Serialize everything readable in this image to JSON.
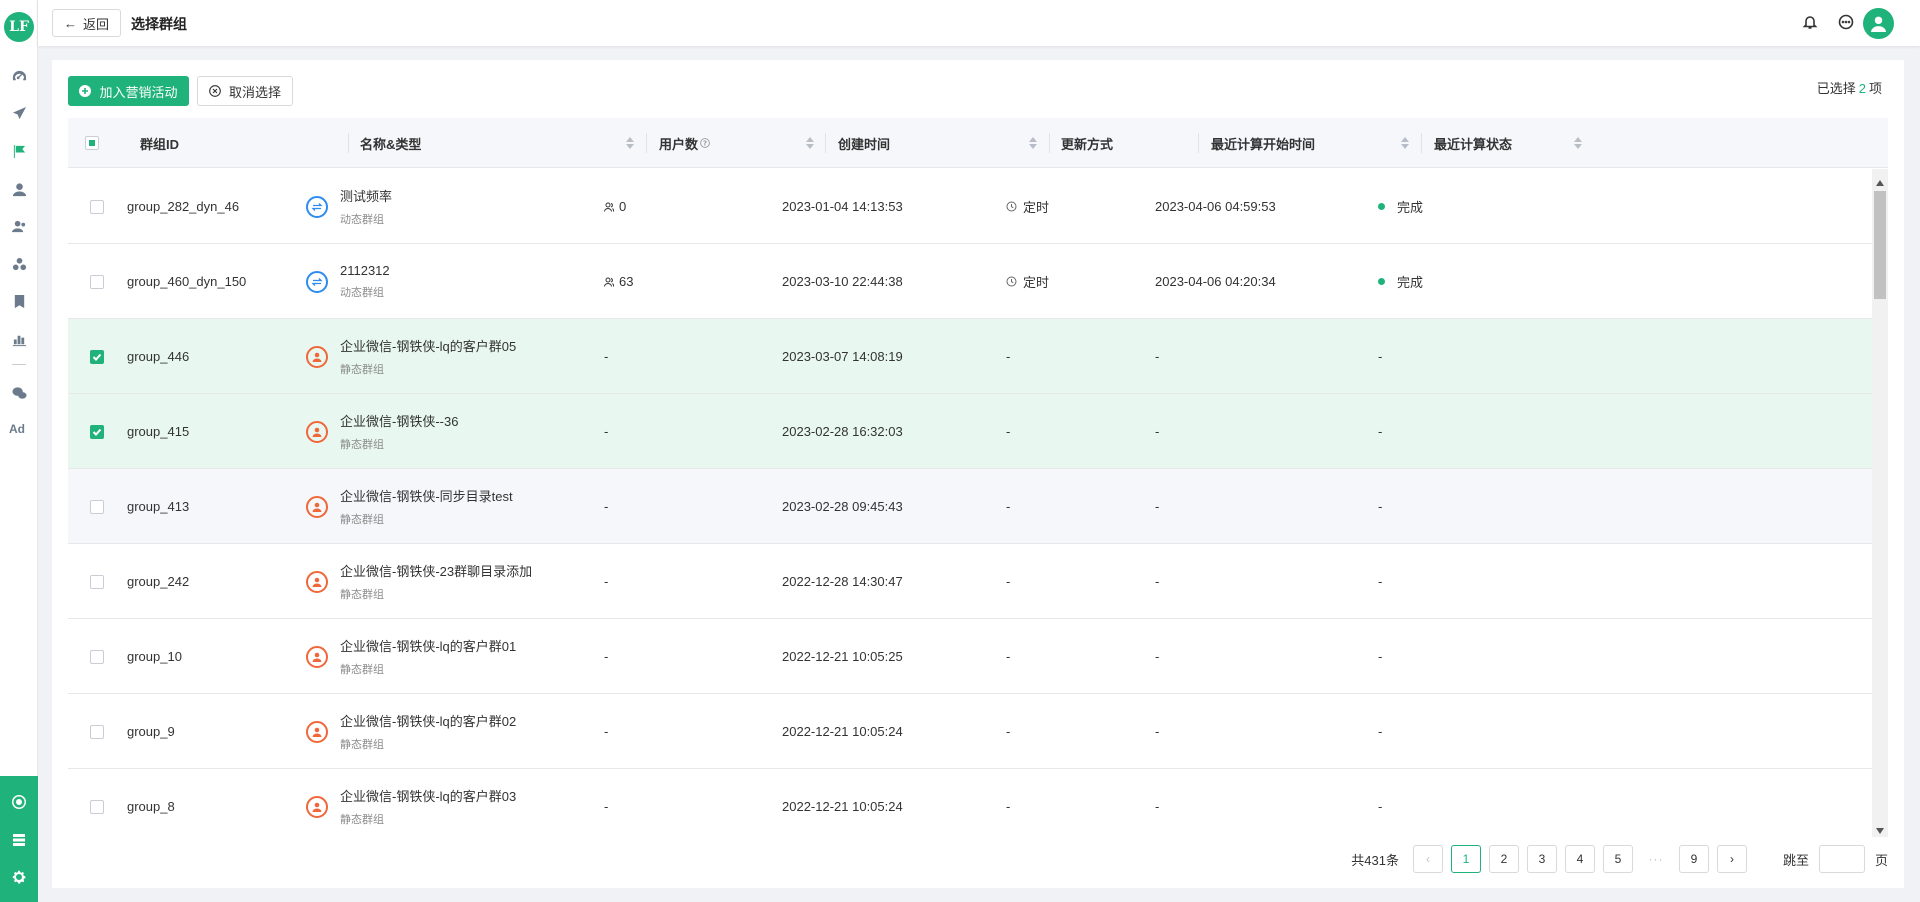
{
  "sidebar": {
    "logo_text": "LF",
    "nav_icons": [
      "dashboard-icon",
      "send-icon",
      "flag-icon",
      "user-icon",
      "users-icon",
      "cluster-icon",
      "bookmark-icon",
      "bar-chart-icon",
      "wechat-icon"
    ],
    "ad_label": "Ad",
    "bottom_icons": [
      "hub-icon",
      "server-icon",
      "settings-icon"
    ]
  },
  "header": {
    "back_label": "返回",
    "title": "选择群组"
  },
  "toolbar": {
    "add_label": "加入营销活动",
    "cancel_label": "取消选择",
    "selected_prefix": "已选择",
    "selected_count": "2",
    "selected_suffix": "项"
  },
  "table": {
    "columns": [
      "群组ID",
      "名称&类型",
      "用户数",
      "创建时间",
      "更新方式",
      "最近计算开始时间",
      "最近计算状态"
    ],
    "rows": [
      {
        "id": "group_282_dyn_46",
        "name": "测试频率",
        "type": "动态群组",
        "kind": "dyn",
        "users": "0",
        "created": "2023-01-04 14:13:53",
        "update": "定时",
        "last_calc": "2023-04-06 04:59:53",
        "status": "完成",
        "checked": false
      },
      {
        "id": "group_460_dyn_150",
        "name": "2112312",
        "type": "动态群组",
        "kind": "dyn",
        "users": "63",
        "created": "2023-03-10 22:44:38",
        "update": "定时",
        "last_calc": "2023-04-06 04:20:34",
        "status": "完成",
        "checked": false
      },
      {
        "id": "group_446",
        "name": "企业微信-钢铁侠-lq的客户群05",
        "type": "静态群组",
        "kind": "sta",
        "users": "-",
        "created": "2023-03-07 14:08:19",
        "update": "-",
        "last_calc": "-",
        "status": "-",
        "checked": true
      },
      {
        "id": "group_415",
        "name": "企业微信-钢铁侠--36",
        "type": "静态群组",
        "kind": "sta",
        "users": "-",
        "created": "2023-02-28 16:32:03",
        "update": "-",
        "last_calc": "-",
        "status": "-",
        "checked": true
      },
      {
        "id": "group_413",
        "name": "企业微信-钢铁侠-同步目录test",
        "type": "静态群组",
        "kind": "sta",
        "users": "-",
        "created": "2023-02-28 09:45:43",
        "update": "-",
        "last_calc": "-",
        "status": "-",
        "checked": false
      },
      {
        "id": "group_242",
        "name": "企业微信-钢铁侠-23群聊目录添加",
        "type": "静态群组",
        "kind": "sta",
        "users": "-",
        "created": "2022-12-28 14:30:47",
        "update": "-",
        "last_calc": "-",
        "status": "-",
        "checked": false
      },
      {
        "id": "group_10",
        "name": "企业微信-钢铁侠-lq的客户群01",
        "type": "静态群组",
        "kind": "sta",
        "users": "-",
        "created": "2022-12-21 10:05:25",
        "update": "-",
        "last_calc": "-",
        "status": "-",
        "checked": false
      },
      {
        "id": "group_9",
        "name": "企业微信-钢铁侠-lq的客户群02",
        "type": "静态群组",
        "kind": "sta",
        "users": "-",
        "created": "2022-12-21 10:05:24",
        "update": "-",
        "last_calc": "-",
        "status": "-",
        "checked": false
      },
      {
        "id": "group_8",
        "name": "企业微信-钢铁侠-lq的客户群03",
        "type": "静态群组",
        "kind": "sta",
        "users": "-",
        "created": "2022-12-21 10:05:24",
        "update": "-",
        "last_calc": "-",
        "status": "-",
        "checked": false
      }
    ]
  },
  "pagination": {
    "total": "共431条",
    "pages": [
      "1",
      "2",
      "3",
      "4",
      "5"
    ],
    "ellipsis": "···",
    "last_page": "9",
    "current": "1",
    "jump_label": "跳至",
    "page_unit": "页"
  },
  "colors": {
    "accent": "#1fb27a",
    "dynamic": "#2d8cf0",
    "static": "#f0673a",
    "selected_row": "#e8f8f0"
  }
}
